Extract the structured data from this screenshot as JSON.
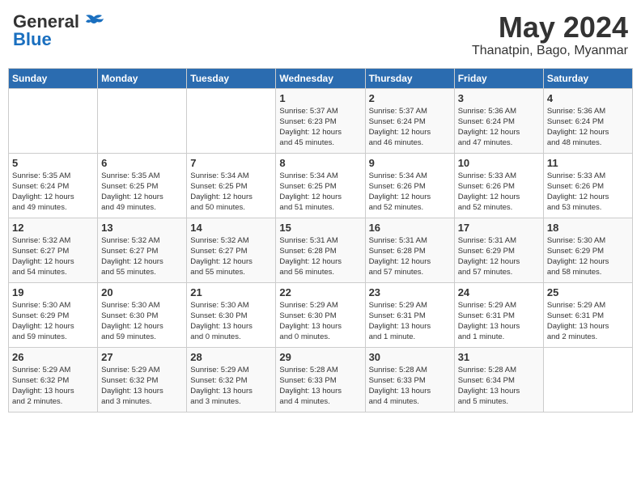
{
  "logo": {
    "general": "General",
    "blue": "Blue"
  },
  "title": "May 2024",
  "subtitle": "Thanatpin, Bago, Myanmar",
  "headers": [
    "Sunday",
    "Monday",
    "Tuesday",
    "Wednesday",
    "Thursday",
    "Friday",
    "Saturday"
  ],
  "weeks": [
    [
      {
        "day": "",
        "info": ""
      },
      {
        "day": "",
        "info": ""
      },
      {
        "day": "",
        "info": ""
      },
      {
        "day": "1",
        "info": "Sunrise: 5:37 AM\nSunset: 6:23 PM\nDaylight: 12 hours\nand 45 minutes."
      },
      {
        "day": "2",
        "info": "Sunrise: 5:37 AM\nSunset: 6:24 PM\nDaylight: 12 hours\nand 46 minutes."
      },
      {
        "day": "3",
        "info": "Sunrise: 5:36 AM\nSunset: 6:24 PM\nDaylight: 12 hours\nand 47 minutes."
      },
      {
        "day": "4",
        "info": "Sunrise: 5:36 AM\nSunset: 6:24 PM\nDaylight: 12 hours\nand 48 minutes."
      }
    ],
    [
      {
        "day": "5",
        "info": "Sunrise: 5:35 AM\nSunset: 6:24 PM\nDaylight: 12 hours\nand 49 minutes."
      },
      {
        "day": "6",
        "info": "Sunrise: 5:35 AM\nSunset: 6:25 PM\nDaylight: 12 hours\nand 49 minutes."
      },
      {
        "day": "7",
        "info": "Sunrise: 5:34 AM\nSunset: 6:25 PM\nDaylight: 12 hours\nand 50 minutes."
      },
      {
        "day": "8",
        "info": "Sunrise: 5:34 AM\nSunset: 6:25 PM\nDaylight: 12 hours\nand 51 minutes."
      },
      {
        "day": "9",
        "info": "Sunrise: 5:34 AM\nSunset: 6:26 PM\nDaylight: 12 hours\nand 52 minutes."
      },
      {
        "day": "10",
        "info": "Sunrise: 5:33 AM\nSunset: 6:26 PM\nDaylight: 12 hours\nand 52 minutes."
      },
      {
        "day": "11",
        "info": "Sunrise: 5:33 AM\nSunset: 6:26 PM\nDaylight: 12 hours\nand 53 minutes."
      }
    ],
    [
      {
        "day": "12",
        "info": "Sunrise: 5:32 AM\nSunset: 6:27 PM\nDaylight: 12 hours\nand 54 minutes."
      },
      {
        "day": "13",
        "info": "Sunrise: 5:32 AM\nSunset: 6:27 PM\nDaylight: 12 hours\nand 55 minutes."
      },
      {
        "day": "14",
        "info": "Sunrise: 5:32 AM\nSunset: 6:27 PM\nDaylight: 12 hours\nand 55 minutes."
      },
      {
        "day": "15",
        "info": "Sunrise: 5:31 AM\nSunset: 6:28 PM\nDaylight: 12 hours\nand 56 minutes."
      },
      {
        "day": "16",
        "info": "Sunrise: 5:31 AM\nSunset: 6:28 PM\nDaylight: 12 hours\nand 57 minutes."
      },
      {
        "day": "17",
        "info": "Sunrise: 5:31 AM\nSunset: 6:29 PM\nDaylight: 12 hours\nand 57 minutes."
      },
      {
        "day": "18",
        "info": "Sunrise: 5:30 AM\nSunset: 6:29 PM\nDaylight: 12 hours\nand 58 minutes."
      }
    ],
    [
      {
        "day": "19",
        "info": "Sunrise: 5:30 AM\nSunset: 6:29 PM\nDaylight: 12 hours\nand 59 minutes."
      },
      {
        "day": "20",
        "info": "Sunrise: 5:30 AM\nSunset: 6:30 PM\nDaylight: 12 hours\nand 59 minutes."
      },
      {
        "day": "21",
        "info": "Sunrise: 5:30 AM\nSunset: 6:30 PM\nDaylight: 13 hours\nand 0 minutes."
      },
      {
        "day": "22",
        "info": "Sunrise: 5:29 AM\nSunset: 6:30 PM\nDaylight: 13 hours\nand 0 minutes."
      },
      {
        "day": "23",
        "info": "Sunrise: 5:29 AM\nSunset: 6:31 PM\nDaylight: 13 hours\nand 1 minute."
      },
      {
        "day": "24",
        "info": "Sunrise: 5:29 AM\nSunset: 6:31 PM\nDaylight: 13 hours\nand 1 minute."
      },
      {
        "day": "25",
        "info": "Sunrise: 5:29 AM\nSunset: 6:31 PM\nDaylight: 13 hours\nand 2 minutes."
      }
    ],
    [
      {
        "day": "26",
        "info": "Sunrise: 5:29 AM\nSunset: 6:32 PM\nDaylight: 13 hours\nand 2 minutes."
      },
      {
        "day": "27",
        "info": "Sunrise: 5:29 AM\nSunset: 6:32 PM\nDaylight: 13 hours\nand 3 minutes."
      },
      {
        "day": "28",
        "info": "Sunrise: 5:29 AM\nSunset: 6:32 PM\nDaylight: 13 hours\nand 3 minutes."
      },
      {
        "day": "29",
        "info": "Sunrise: 5:28 AM\nSunset: 6:33 PM\nDaylight: 13 hours\nand 4 minutes."
      },
      {
        "day": "30",
        "info": "Sunrise: 5:28 AM\nSunset: 6:33 PM\nDaylight: 13 hours\nand 4 minutes."
      },
      {
        "day": "31",
        "info": "Sunrise: 5:28 AM\nSunset: 6:34 PM\nDaylight: 13 hours\nand 5 minutes."
      },
      {
        "day": "",
        "info": ""
      }
    ]
  ]
}
